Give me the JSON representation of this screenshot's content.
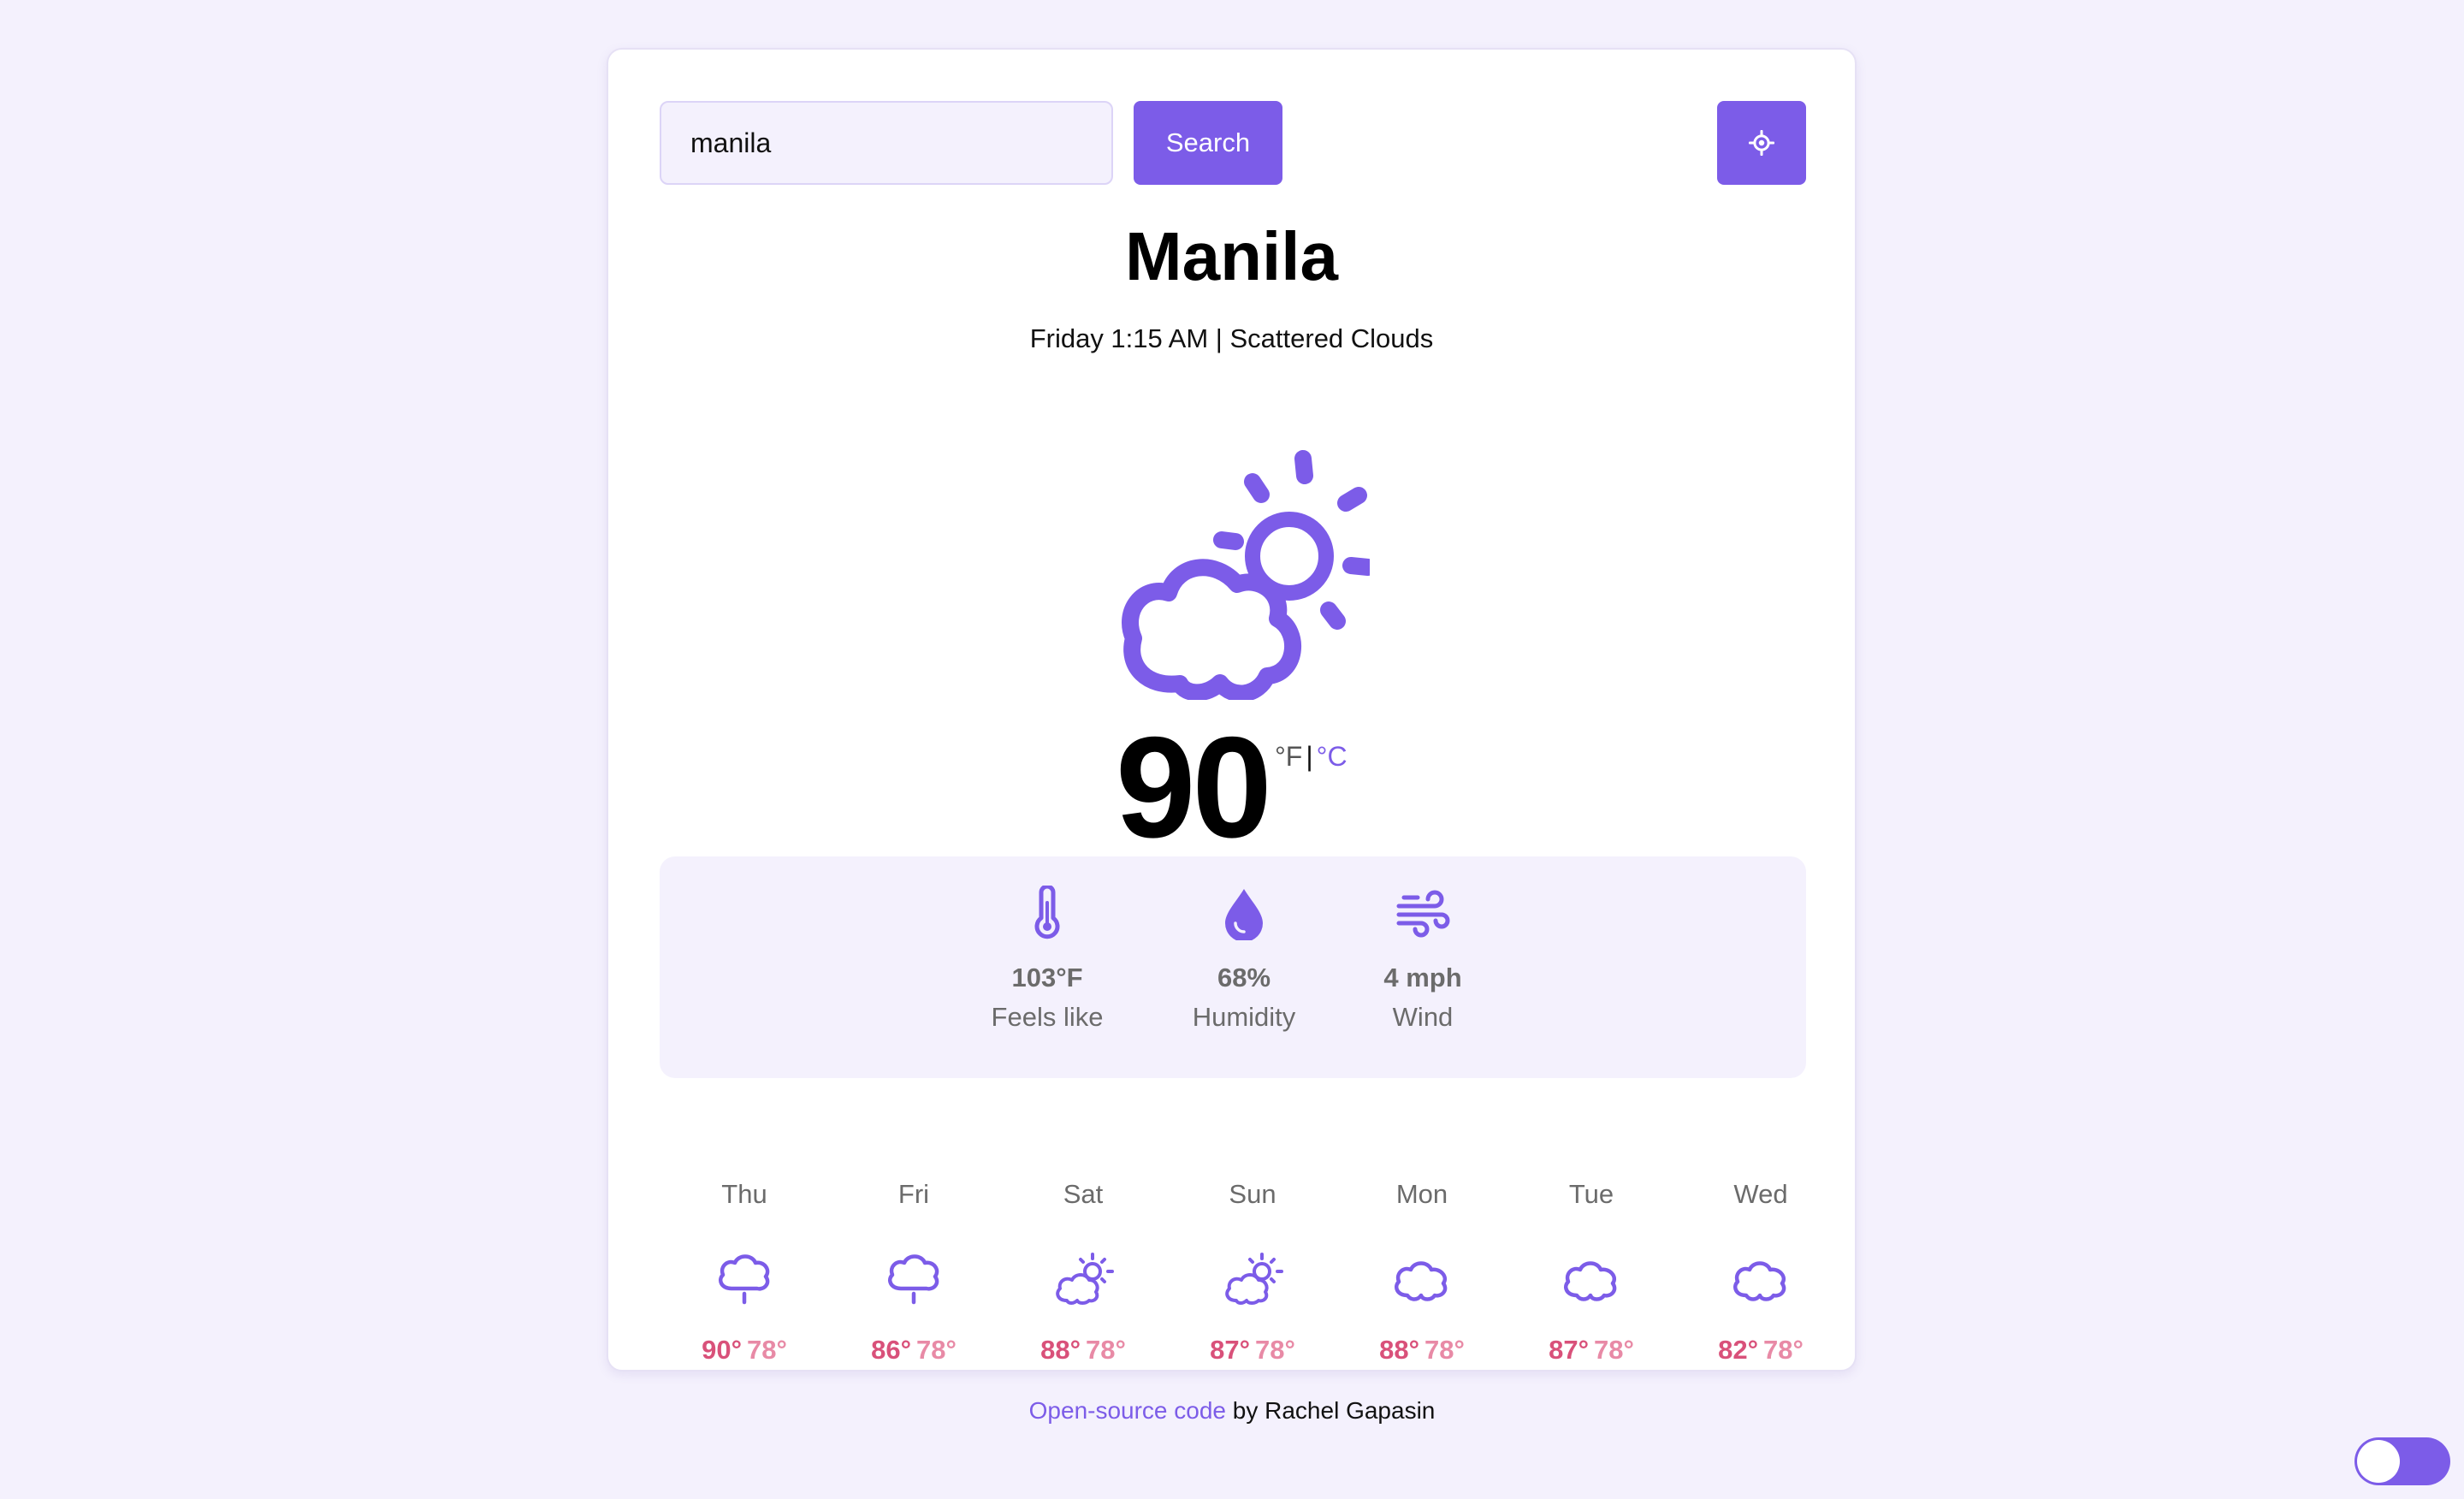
{
  "search": {
    "value": "manila",
    "button_label": "Search",
    "location_icon": "crosshair-icon"
  },
  "current": {
    "city": "Manila",
    "day_time": "Friday 1:15 AM",
    "separator": "|",
    "condition": "Scattered Clouds",
    "icon": "partly-cloudy-icon",
    "temperature": "90",
    "unit_f": "°F",
    "unit_sep": "|",
    "unit_c": "°C"
  },
  "stats": [
    {
      "icon": "thermometer-icon",
      "value": "103°F",
      "label": "Feels like"
    },
    {
      "icon": "droplet-icon",
      "value": "68%",
      "label": "Humidity"
    },
    {
      "icon": "wind-icon",
      "value": "4 mph",
      "label": "Wind"
    }
  ],
  "forecast": [
    {
      "day": "Thu",
      "icon": "drizzle-cloud-icon",
      "high": "90°",
      "low": "78°"
    },
    {
      "day": "Fri",
      "icon": "drizzle-cloud-icon",
      "high": "86°",
      "low": "78°"
    },
    {
      "day": "Sat",
      "icon": "partly-cloudy-icon",
      "high": "88°",
      "low": "78°"
    },
    {
      "day": "Sun",
      "icon": "partly-cloudy-icon",
      "high": "87°",
      "low": "78°"
    },
    {
      "day": "Mon",
      "icon": "cloud-icon",
      "high": "88°",
      "low": "78°"
    },
    {
      "day": "Tue",
      "icon": "cloud-icon",
      "high": "87°",
      "low": "78°"
    },
    {
      "day": "Wed",
      "icon": "cloud-icon",
      "high": "82°",
      "low": "78°"
    }
  ],
  "footer": {
    "link_text": "Open-source code",
    "author_text": " by Rachel Gapasin"
  },
  "theme_toggle": {
    "state": "on"
  },
  "colors": {
    "accent": "#7c5ce8",
    "background": "#f4f1fd",
    "high_temp": "#d9517a",
    "low_temp": "#e88aa6"
  }
}
